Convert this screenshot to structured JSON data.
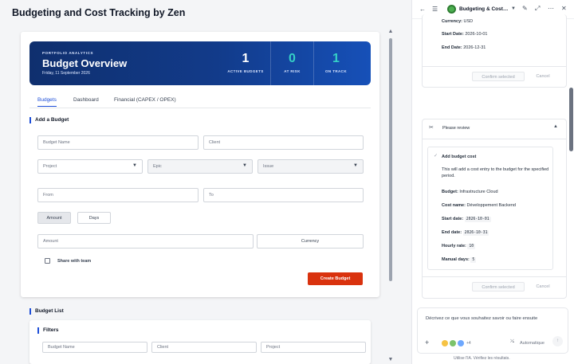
{
  "app": {
    "title": "Budgeting and Cost Tracking by Zen"
  },
  "hero": {
    "kicker": "PORTFOLIO ANALYTICS",
    "title": "Budget Overview",
    "date": "Friday, 11 September 2026",
    "stats": [
      {
        "value": "1",
        "label": "ACTIVE BUDGETS"
      },
      {
        "value": "0",
        "label": "AT RISK"
      },
      {
        "value": "1",
        "label": "ON TRACK"
      }
    ]
  },
  "tabs": [
    {
      "label": "Budgets",
      "active": true
    },
    {
      "label": "Dashboard",
      "active": false
    },
    {
      "label": "Financial (CAPEX / OPEX)",
      "active": false
    }
  ],
  "add_budget": {
    "heading": "Add a Budget",
    "budget_name_placeholder": "Budget Name",
    "client_placeholder": "Client",
    "project_placeholder": "Project",
    "epic_placeholder": "Epic",
    "issue_placeholder": "Issue",
    "from_placeholder": "From",
    "to_placeholder": "To",
    "mode_amount": "Amount",
    "mode_days": "Days",
    "amount_placeholder": "Amount",
    "currency_label": "Currency",
    "share_label": "Share with team",
    "create_button": "Create Budget"
  },
  "budget_list": {
    "heading": "Budget List",
    "filters_heading": "Filters",
    "filter_budget_name": "Budget Name",
    "filter_client": "Client",
    "filter_project": "Project"
  },
  "assistant": {
    "title": "Budgeting & Cost…",
    "first_card": {
      "currency_label": "Currency:",
      "currency_value": "USD",
      "start_label": "Start Date:",
      "start_value": "2026-10-01",
      "end_label": "End Date:",
      "end_value": "2026-12-31",
      "confirm": "Confirm selected",
      "cancel": "Cancel"
    },
    "review_card": {
      "header": "Please review",
      "action_title": "Add budget cost",
      "description": "This will add a cost entry to the budget for the specified period.",
      "budget_label": "Budget:",
      "budget_value": "Infrastructure Cloud",
      "cost_name_label": "Cost name:",
      "cost_name_value": "Développement Backend",
      "start_label": "Start date:",
      "start_value": "2026-10-01",
      "end_label": "End date:",
      "end_value": "2026-10-31",
      "rate_label": "Hourly rate:",
      "rate_value": "10",
      "days_label": "Manual days:",
      "days_value": "5",
      "confirm": "Confirm selected",
      "cancel": "Cancel"
    },
    "compose": {
      "placeholder": "Décrivez ce que vous souhaitez savoir ou faire ensuite",
      "extra_count": "+4",
      "mode": "Automatique"
    },
    "footer": "Utilise l'IA. Vérifiez les résultats."
  },
  "colors": {
    "hero_start": "#0f2f6e",
    "hero_end": "#1650b8",
    "accent_blue": "#1d4ed8",
    "stat_teal": "#35d0c6",
    "primary_button": "#d9320e"
  }
}
